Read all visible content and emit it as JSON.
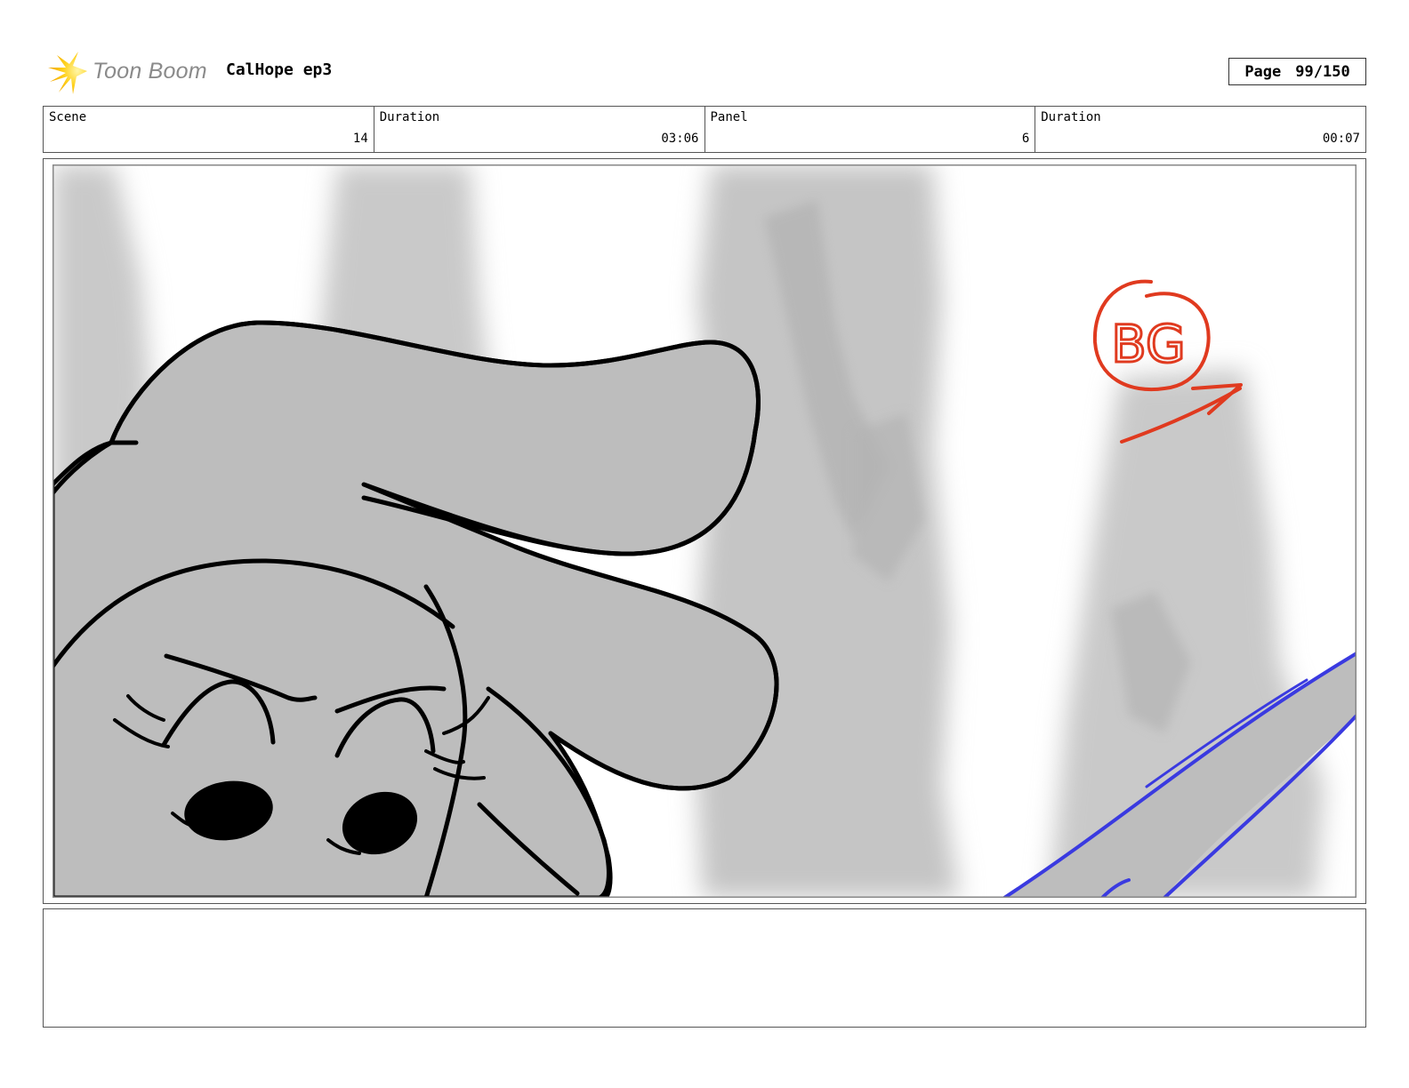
{
  "header": {
    "logo_text": "Toon Boom",
    "project_title": "CalHope ep3",
    "page_label": "Page",
    "page_number": "99/150"
  },
  "info": {
    "scene_label": "Scene",
    "scene_value": "14",
    "scene_duration_label": "Duration",
    "scene_duration_value": "03:06",
    "panel_label": "Panel",
    "panel_value": "6",
    "panel_duration_label": "Duration",
    "panel_duration_value": "00:07"
  },
  "panel": {
    "annotation_text": "BG"
  },
  "notes": {
    "text": ""
  }
}
